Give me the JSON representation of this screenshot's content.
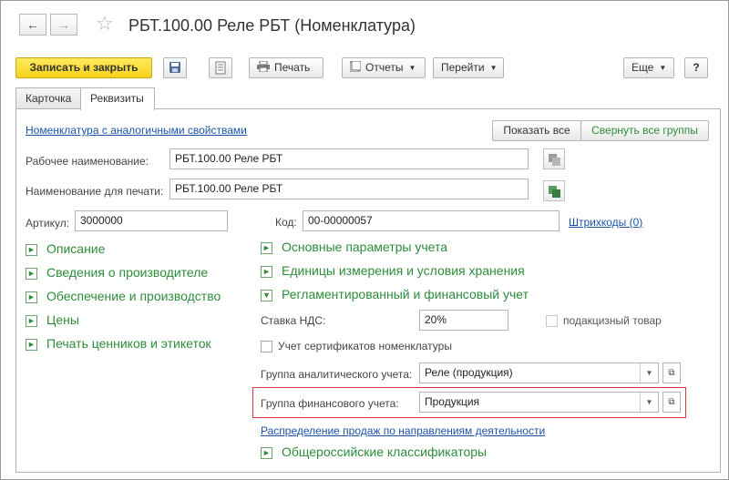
{
  "title": "РБТ.100.00 Реле РБТ (Номенклатура)",
  "toolbar": {
    "save_close": "Записать и закрыть",
    "print": "Печать",
    "reports": "Отчеты",
    "goto": "Перейти",
    "more": "Еще",
    "help": "?"
  },
  "tabs": [
    "Карточка",
    "Реквизиты"
  ],
  "links": {
    "similar": "Номенклатура с аналогичными свойствами",
    "barcodes": "Штрихкоды (0)",
    "distribution": "Распределение продаж по направлениям деятельности"
  },
  "buttons": {
    "show_all": "Показать все",
    "collapse_all": "Свернуть все группы"
  },
  "fields": {
    "work_name_label": "Рабочее наименование:",
    "work_name_value": "РБТ.100.00 Реле РБТ",
    "print_name_label": "Наименование для печати:",
    "print_name_value": "РБТ.100.00 Реле РБТ",
    "article_label": "Артикул:",
    "article_value": "3000000",
    "code_label": "Код:",
    "code_value": "00-00000057",
    "vat_label": "Ставка НДС:",
    "vat_value": "20%",
    "excise_label": "подакцизный товар",
    "certs_label": "Учет сертификатов номенклатуры",
    "analytic_group_label": "Группа аналитического учета:",
    "analytic_group_value": "Реле (продукция)",
    "fin_group_label": "Группа финансового учета:",
    "fin_group_value": "Продукция"
  },
  "groups_left": [
    "Описание",
    "Сведения о производителе",
    "Обеспечение и производство",
    "Цены",
    "Печать ценников и этикеток"
  ],
  "groups_right": [
    "Основные параметры учета",
    "Единицы измерения и условия хранения",
    "Регламентированный и финансовый учет"
  ],
  "group_bottom": "Общероссийские классификаторы",
  "colors": {
    "primary_button": "#f7d21b",
    "group_text": "#2e8b3a",
    "link": "#1a54a8",
    "highlight": "#d9363e"
  }
}
